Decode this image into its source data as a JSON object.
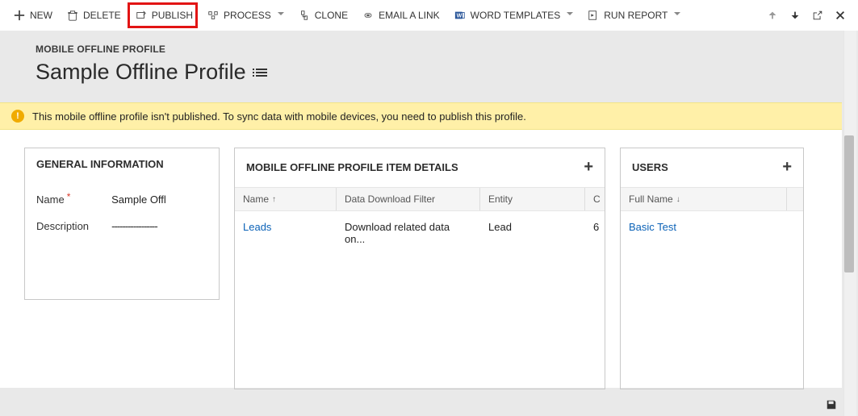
{
  "toolbar": {
    "new_label": "NEW",
    "delete_label": "DELETE",
    "publish_label": "PUBLISH",
    "process_label": "PROCESS",
    "clone_label": "CLONE",
    "email_link_label": "EMAIL A LINK",
    "word_templates_label": "WORD TEMPLATES",
    "run_report_label": "RUN REPORT"
  },
  "breadcrumb": "MOBILE OFFLINE PROFILE",
  "page_title": "Sample Offline Profile",
  "notification": "This mobile offline profile isn't published. To sync data with mobile devices, you need to publish this profile.",
  "general": {
    "heading": "GENERAL INFORMATION",
    "name_label": "Name",
    "name_value": "Sample Offl",
    "description_label": "Description",
    "description_value": "-----------------"
  },
  "items": {
    "heading": "MOBILE OFFLINE PROFILE ITEM DETAILS",
    "col_name": "Name",
    "col_filter": "Data Download Filter",
    "col_entity": "Entity",
    "col_created": "C",
    "rows": [
      {
        "name": "Leads",
        "filter": "Download related data on...",
        "entity": "Lead",
        "created": "6"
      }
    ]
  },
  "users": {
    "heading": "USERS",
    "col_fullname": "Full Name",
    "rows": [
      {
        "name": "Basic Test"
      }
    ]
  }
}
